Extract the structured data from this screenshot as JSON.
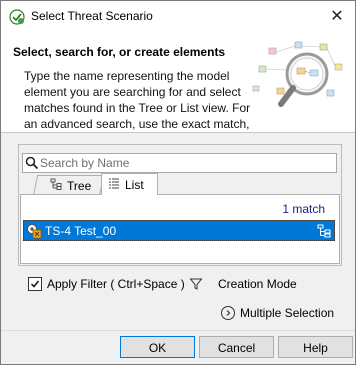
{
  "window": {
    "title": "Select Threat Scenario",
    "close_glyph": "✕"
  },
  "header": {
    "title": "Select, search for, or create elements",
    "description": "Type the name representing the model element you are searching for and select matches found in the Tree or List view. For an advanced search, use the exact match,"
  },
  "search": {
    "placeholder": "Search by Name",
    "value": ""
  },
  "tabs": [
    {
      "label": "Tree",
      "selected": false
    },
    {
      "label": "List",
      "selected": true
    }
  ],
  "results": {
    "match_count": "1 match",
    "items": [
      {
        "label": "TS-4 Test_00",
        "selected": true
      }
    ]
  },
  "options": {
    "apply_filter_label": "Apply Filter ( Ctrl+Space )",
    "apply_filter_checked": true,
    "creation_mode_label": "Creation Mode",
    "multiple_selection_label": "Multiple Selection"
  },
  "buttons": {
    "ok": "OK",
    "cancel": "Cancel",
    "help": "Help"
  },
  "colors": {
    "selection": "#0078d7",
    "match_text": "#1a1a8c"
  }
}
